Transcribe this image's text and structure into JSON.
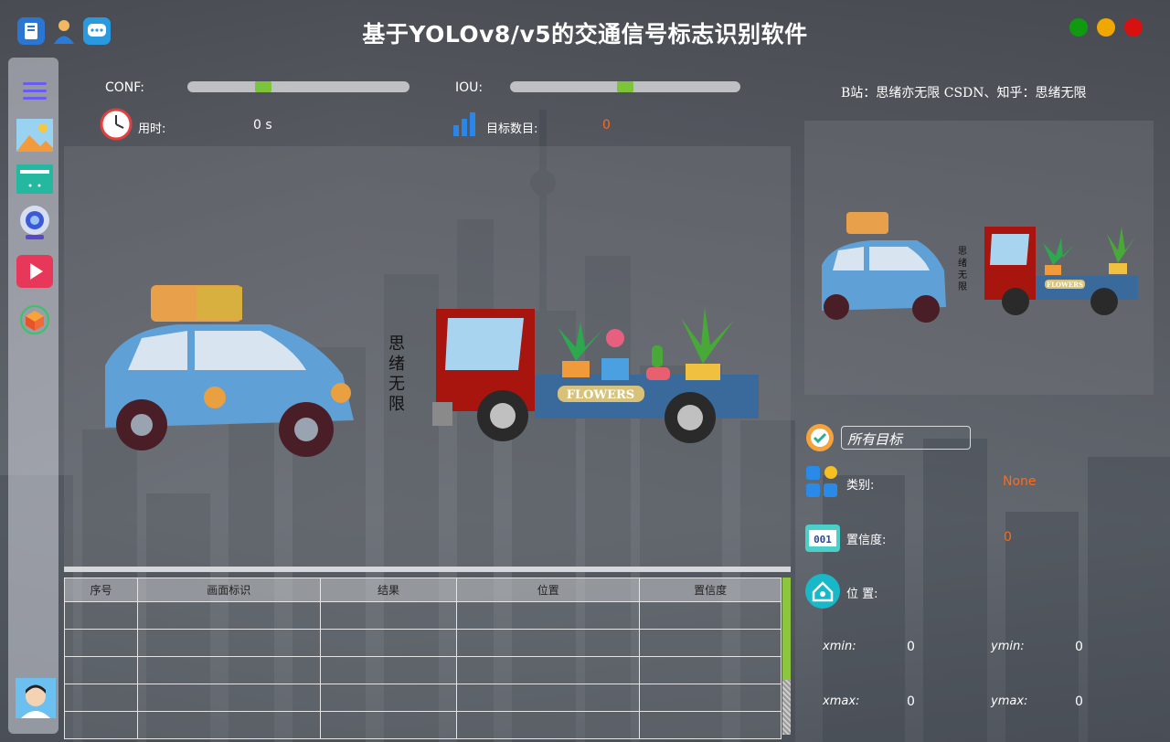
{
  "window": {
    "title": "基于YOLOv8/v5的交通信号标志识别软件",
    "colors": {
      "green": "#109a10",
      "yellow": "#f0a800",
      "red": "#d81010"
    }
  },
  "topbar_icons": [
    "book-icon",
    "user-icon",
    "chat-icon"
  ],
  "sidebar": {
    "items": [
      "menu-icon",
      "image-icon",
      "folder-icon",
      "camera-icon",
      "video-icon",
      "model-icon"
    ]
  },
  "controls": {
    "conf_label": "CONF:",
    "iou_label": "IOU:",
    "conf_value": 0.33,
    "iou_value": 0.5
  },
  "stats": {
    "time_label": "用时:",
    "time_value": "0 s",
    "count_label": "目标数目:",
    "count_value": "0"
  },
  "credit": "B站：思绪亦无限  CSDN、知乎：思绪无限",
  "image": {
    "sign_text": "思绪无限",
    "truck_text": "FLOWERS"
  },
  "table": {
    "headers": [
      "序号",
      "画面标识",
      "结果",
      "位置",
      "置信度"
    ],
    "rows": 5
  },
  "detail": {
    "filter_value": "所有目标",
    "class_label": "类别:",
    "class_value": "None",
    "conf_label": "置信度:",
    "conf_value": "0",
    "pos_label": "位 置:",
    "xmin_label": "xmin:",
    "xmin_value": "0",
    "ymin_label": "ymin:",
    "ymin_value": "0",
    "xmax_label": "xmax:",
    "xmax_value": "0",
    "ymax_label": "ymax:",
    "ymax_value": "0"
  }
}
